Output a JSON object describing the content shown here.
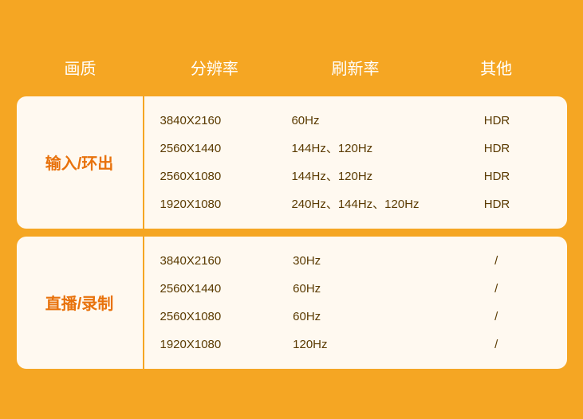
{
  "header": {
    "col1": "画质",
    "col2": "分辨率",
    "col3": "刷新率",
    "col4": "其他"
  },
  "sections": [
    {
      "id": "input-output",
      "label": "输入/环出",
      "rows": [
        {
          "resolution": "3840X2160",
          "refresh": "60Hz",
          "other": "HDR"
        },
        {
          "resolution": "2560X1440",
          "refresh": "144Hz、120Hz",
          "other": "HDR"
        },
        {
          "resolution": "2560X1080",
          "refresh": "144Hz、120Hz",
          "other": "HDR"
        },
        {
          "resolution": "1920X1080",
          "refresh": "240Hz、144Hz、120Hz",
          "other": "HDR"
        }
      ]
    },
    {
      "id": "live-record",
      "label": "直播/录制",
      "rows": [
        {
          "resolution": "3840X2160",
          "refresh": "30Hz",
          "other": "/"
        },
        {
          "resolution": "2560X1440",
          "refresh": "60Hz",
          "other": "/"
        },
        {
          "resolution": "2560X1080",
          "refresh": "60Hz",
          "other": "/"
        },
        {
          "resolution": "1920X1080",
          "refresh": "120Hz",
          "other": "/"
        }
      ]
    }
  ],
  "colors": {
    "background": "#f5a623",
    "header_text": "#ffffff",
    "label_text": "#e8720c",
    "cell_text": "#5a3a00",
    "card_bg": "#fff9f0"
  }
}
